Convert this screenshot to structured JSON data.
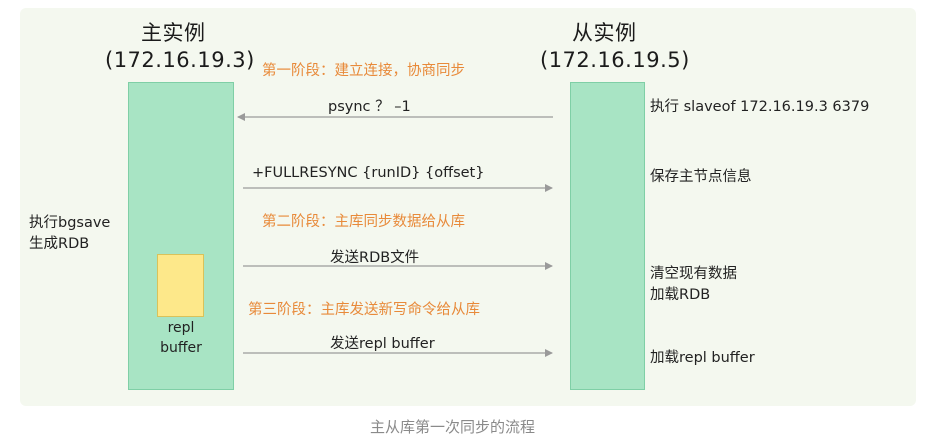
{
  "master": {
    "title": "主实例",
    "ip": "(172.16.19.3)"
  },
  "slave": {
    "title": "从实例",
    "ip": "(172.16.19.5)"
  },
  "phases": {
    "phase1": "第一阶段：建立连接，协商同步",
    "phase2": "第二阶段：主库同步数据给从库",
    "phase3": "第三阶段：主库发送新写命令给从库"
  },
  "messages": {
    "psync": "psync ？ –1",
    "fullresync": "+FULLRESYNC {runID} {offset}",
    "send_rdb": "发送RDB文件",
    "send_repl": "发送repl buffer"
  },
  "master_notes": {
    "line1": "执行bgsave",
    "line2": "生成RDB"
  },
  "buffer": {
    "line1": "repl",
    "line2": "buffer"
  },
  "slave_notes": {
    "cmd": "执行 slaveof  172.16.19.3  6379",
    "save_info": "保存主节点信息",
    "clear_line1": "清空现有数据",
    "clear_line2": "加载RDB",
    "load_repl": "加载repl buffer"
  },
  "caption": "主从库第一次同步的流程",
  "colors": {
    "panel": "#f4f8ef",
    "box": "#a8e4c4",
    "buffer": "#fde88a",
    "phase_text": "#e88a3a",
    "arrow": "#9a9a9a"
  }
}
